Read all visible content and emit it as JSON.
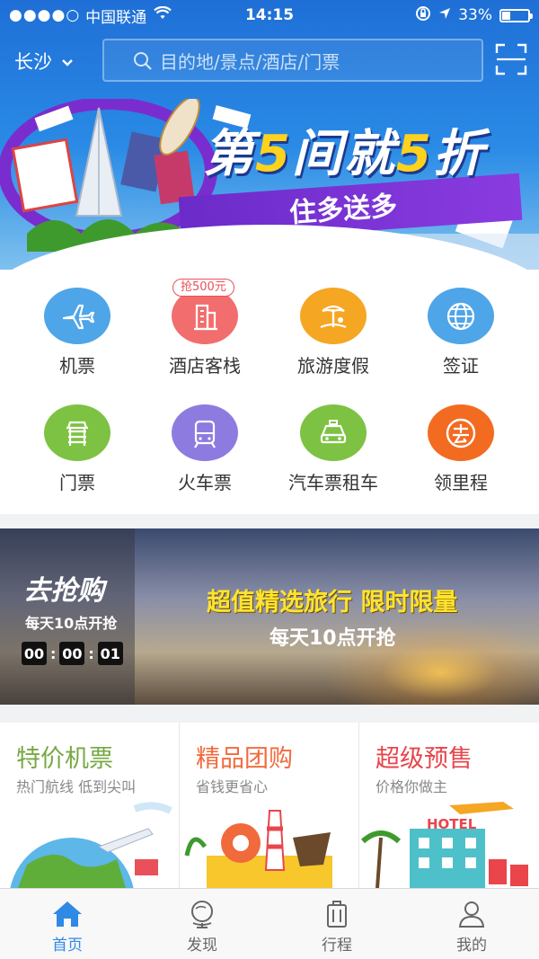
{
  "status_bar": {
    "carrier": "中国联通",
    "time": "14:15",
    "battery": "33%",
    "battery_level": 0.33
  },
  "header": {
    "city": "长沙",
    "search_placeholder": "目的地/景点/酒店/门票"
  },
  "banner": {
    "title_prefix": "第",
    "title_num1": "5",
    "title_mid": "间就",
    "title_num2": "5",
    "title_suffix": "折",
    "subtitle": "住多送多"
  },
  "services": [
    {
      "label": "机票",
      "icon": "airplane-icon",
      "color": "#4ea5e8"
    },
    {
      "label": "酒店客栈",
      "icon": "hotel-icon",
      "color": "#f26d6d",
      "badge": "抢500元"
    },
    {
      "label": "旅游度假",
      "icon": "palm-tree-icon",
      "color": "#f5a623"
    },
    {
      "label": "签证",
      "icon": "globe-icon",
      "color": "#4ea5e8"
    },
    {
      "label": "门票",
      "icon": "ticket-gate-icon",
      "color": "#7dc243"
    },
    {
      "label": "火车票",
      "icon": "train-icon",
      "color": "#8e7be0"
    },
    {
      "label": "汽车票租车",
      "icon": "car-icon",
      "color": "#7dc243"
    },
    {
      "label": "领里程",
      "icon": "qu-mileage-icon",
      "color": "#f36b21"
    }
  ],
  "flash_sale": {
    "brand": "去抢购",
    "daily": "每天10点开抢",
    "timer": [
      "00",
      "00",
      "01"
    ],
    "headline": "超值精选旅行 限时限量",
    "sub": "每天10点开抢"
  },
  "cards": [
    {
      "title": "特价机票",
      "subtitle": "热门航线 低到尖叫",
      "color": "#77a843"
    },
    {
      "title": "精品团购",
      "subtitle": "省钱更省心",
      "color": "#f26a3c"
    },
    {
      "title": "超级预售",
      "subtitle": "价格你做主",
      "color": "#e8454b",
      "hotel_sign": "HOTEL"
    }
  ],
  "tabs": [
    {
      "label": "首页",
      "icon": "home-icon",
      "active": true
    },
    {
      "label": "发现",
      "icon": "globe-stand-icon",
      "active": false
    },
    {
      "label": "行程",
      "icon": "luggage-icon",
      "active": false
    },
    {
      "label": "我的",
      "icon": "user-icon",
      "active": false
    }
  ],
  "colors": {
    "accent": "#2f8ae5",
    "banner_yellow": "#ffd21e"
  }
}
